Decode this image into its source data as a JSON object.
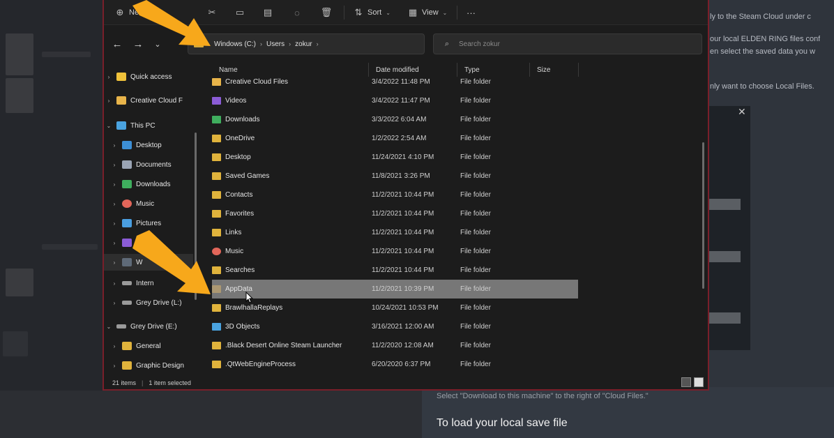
{
  "background": {
    "steam_text_lines": [
      "ly to the Steam Cloud under c",
      "our local ELDEN RING files conf",
      "en select the saved data you w",
      "nly want to choose Local Files."
    ],
    "article_line": "Select \"Download to this machine\" to the right of \"Cloud Files.\"",
    "article_heading": "To load your local save file"
  },
  "toolbar": {
    "new_label": "Ne",
    "sort_label": "Sort",
    "view_label": "View",
    "more_label": "···"
  },
  "address": {
    "crumbs": [
      "Windows (C:)",
      "Users",
      "zokur"
    ]
  },
  "search": {
    "placeholder": "Search zokur"
  },
  "sidebar": {
    "items": [
      {
        "label": "Quick access",
        "color": "#f0c23a"
      },
      {
        "label": "Creative Cloud F",
        "color": "#e8b44a"
      },
      {
        "label": "This PC",
        "color": "#4aa3e0"
      },
      {
        "label": "Desktop",
        "color": "#3d8fd6"
      },
      {
        "label": "Documents",
        "color": "#9aa4b4"
      },
      {
        "label": "Downloads",
        "color": "#3fae5e"
      },
      {
        "label": "Music",
        "color": "#e2665a"
      },
      {
        "label": "Pictures",
        "color": "#4a9ee0"
      },
      {
        "label": "V",
        "color": "#8b5cd6"
      },
      {
        "label": "W",
        "color": "#5f6a78"
      },
      {
        "label": "Intern",
        "color": "#9a9a9a"
      },
      {
        "label": "Grey Drive (L:)",
        "color": "#9a9a9a"
      },
      {
        "label": "Grey Drive (E:)",
        "color": "#9a9a9a"
      },
      {
        "label": "General",
        "color": "#e0b33c"
      },
      {
        "label": "Graphic Design",
        "color": "#e0b33c"
      }
    ]
  },
  "columns": {
    "name": "Name",
    "date": "Date modified",
    "type": "Type",
    "size": "Size"
  },
  "files": [
    {
      "name": "Creative Cloud Files",
      "date": "3/4/2022 11:48 PM",
      "type": "File folder",
      "color": "#e8b44a"
    },
    {
      "name": "Videos",
      "date": "3/4/2022 11:47 PM",
      "type": "File folder",
      "color": "#8b5cd6"
    },
    {
      "name": "Downloads",
      "date": "3/3/2022 6:04 AM",
      "type": "File folder",
      "color": "#3fae5e"
    },
    {
      "name": "OneDrive",
      "date": "1/2/2022 2:54 AM",
      "type": "File folder",
      "color": "#e0b33c"
    },
    {
      "name": "Desktop",
      "date": "11/24/2021 4:10 PM",
      "type": "File folder",
      "color": "#e0b33c"
    },
    {
      "name": "Saved Games",
      "date": "11/8/2021 3:26 PM",
      "type": "File folder",
      "color": "#e0b33c"
    },
    {
      "name": "Contacts",
      "date": "11/2/2021 10:44 PM",
      "type": "File folder",
      "color": "#e0b33c"
    },
    {
      "name": "Favorites",
      "date": "11/2/2021 10:44 PM",
      "type": "File folder",
      "color": "#e0b33c"
    },
    {
      "name": "Links",
      "date": "11/2/2021 10:44 PM",
      "type": "File folder",
      "color": "#e0b33c"
    },
    {
      "name": "Music",
      "date": "11/2/2021 10:44 PM",
      "type": "File folder",
      "color": "#e2665a"
    },
    {
      "name": "Searches",
      "date": "11/2/2021 10:44 PM",
      "type": "File folder",
      "color": "#e0b33c"
    },
    {
      "name": "AppData",
      "date": "11/2/2021 10:39 PM",
      "type": "File folder",
      "color": "#b9a070",
      "selected": true
    },
    {
      "name": "BrawlhallaReplays",
      "date": "10/24/2021 10:53 PM",
      "type": "File folder",
      "color": "#e0b33c"
    },
    {
      "name": "3D Objects",
      "date": "3/16/2021 12:00 AM",
      "type": "File folder",
      "color": "#4aa3e0"
    },
    {
      "name": ".Black Desert Online Steam Launcher",
      "date": "11/2/2020 12:08 AM",
      "type": "File folder",
      "color": "#e0b33c"
    },
    {
      "name": ".QtWebEngineProcess",
      "date": "6/20/2020 6:37 PM",
      "type": "File folder",
      "color": "#e0b33c"
    }
  ],
  "status": {
    "items": "21 items",
    "selected": "1 item selected"
  },
  "colors": {
    "window_border": "#7a1f2a",
    "arrow": "#f7a81b",
    "selected_row": "#777777"
  }
}
